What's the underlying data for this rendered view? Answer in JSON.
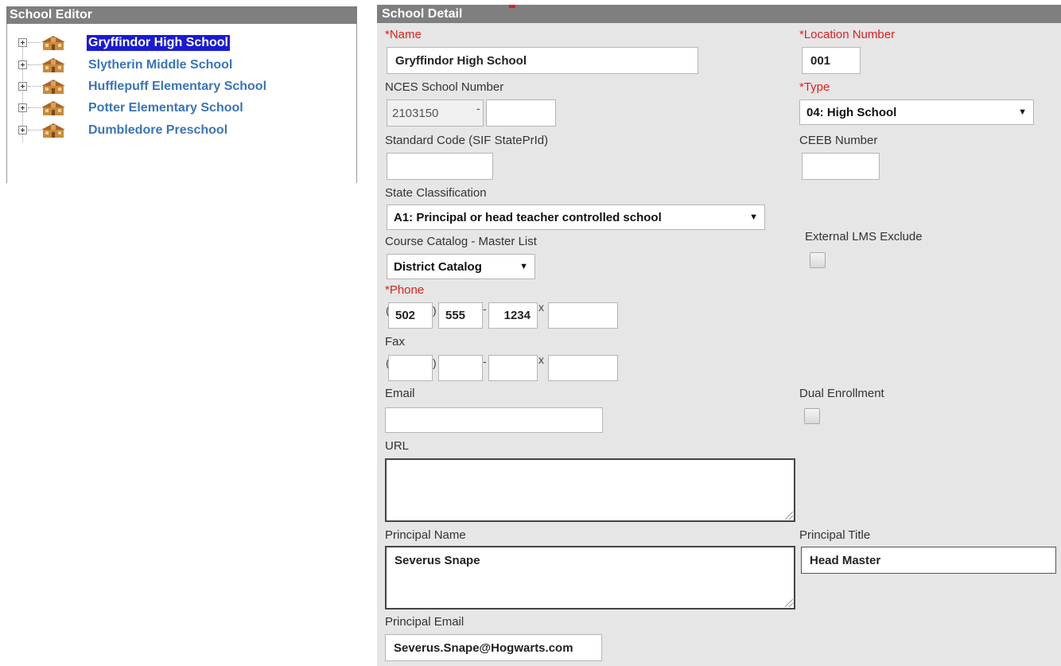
{
  "editor": {
    "title": "School Editor",
    "schools": [
      {
        "label": "Gryffindor High School",
        "selected": true
      },
      {
        "label": "Slytherin Middle School",
        "selected": false
      },
      {
        "label": "Hufflepuff Elementary School",
        "selected": false
      },
      {
        "label": "Potter Elementary School",
        "selected": false
      },
      {
        "label": "Dumbledore Preschool",
        "selected": false
      }
    ]
  },
  "detail": {
    "title": "School Detail",
    "name": {
      "label": "*Name",
      "value": "Gryffindor High School"
    },
    "location_number": {
      "label": "*Location Number",
      "value": "001"
    },
    "nces": {
      "label": "NCES School Number",
      "value1": "2103150",
      "separator": "-",
      "value2": ""
    },
    "type": {
      "label": "*Type",
      "value": "04: High School"
    },
    "standard_code": {
      "label": "Standard Code (SIF StatePrId)",
      "value": ""
    },
    "ceeb": {
      "label": "CEEB Number",
      "value": ""
    },
    "state_classification": {
      "label": "State Classification",
      "value": "A1: Principal or head teacher controlled school"
    },
    "course_catalog": {
      "label": "Course Catalog - Master List",
      "value": "District Catalog"
    },
    "external_lms": {
      "label": "External LMS Exclude",
      "checked": false
    },
    "phone": {
      "label": "*Phone",
      "area": "502",
      "prefix": "555",
      "line": "1234",
      "ext": "",
      "open_paren": "(",
      "close_paren": ")",
      "dash": "-",
      "ext_mark": "x"
    },
    "fax": {
      "label": "Fax",
      "area": "",
      "prefix": "",
      "line": "",
      "ext": ""
    },
    "email": {
      "label": "Email",
      "value": ""
    },
    "dual_enrollment": {
      "label": "Dual Enrollment",
      "checked": false
    },
    "url": {
      "label": "URL",
      "value": ""
    },
    "principal_name": {
      "label": "Principal Name",
      "value": "Severus Snape"
    },
    "principal_title": {
      "label": "Principal Title",
      "value": "Head Master"
    },
    "principal_email": {
      "label": "Principal Email",
      "value": "Severus.Snape@Hogwarts.com"
    }
  },
  "colors": {
    "header_bg": "#7f7f7f",
    "panel_bg": "#e6e6e6",
    "required": "#e0201e",
    "link": "#3a75b8",
    "selection": "#1a1ad6"
  }
}
